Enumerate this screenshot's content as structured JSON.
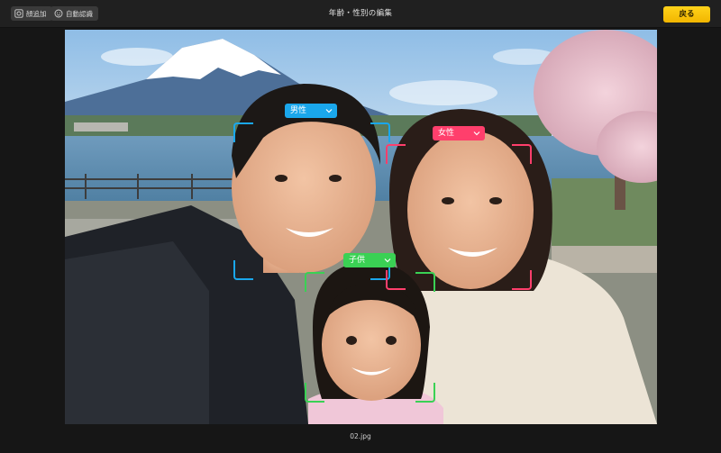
{
  "toolbar": {
    "add_face_label": "顔追加",
    "auto_detect_label": "自動認識",
    "title": "年齢・性別の編集",
    "back_label": "戻る"
  },
  "faces": [
    {
      "label": "男性",
      "color": "#1aa7ec"
    },
    {
      "label": "女性",
      "color": "#ff3f6c"
    },
    {
      "label": "子供",
      "color": "#3ad154"
    }
  ],
  "footer": {
    "filename": "02.jpg"
  },
  "colors": {
    "accent": "#f5bd00",
    "male": "#1aa7ec",
    "female": "#ff3f6c",
    "child": "#3ad154"
  }
}
